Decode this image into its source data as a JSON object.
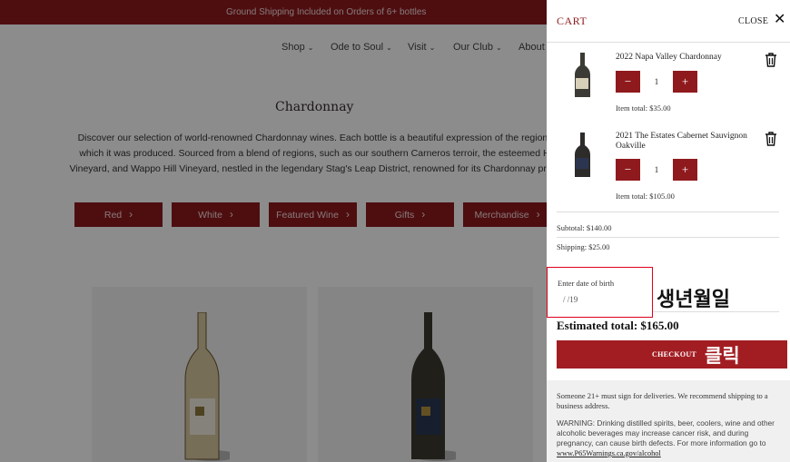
{
  "promo_bar": {
    "text": "Ground Shipping Included on Orders of 6+ bottles"
  },
  "nav": {
    "items": [
      {
        "label": "Shop"
      },
      {
        "label": "Ode to Soul"
      },
      {
        "label": "Visit"
      },
      {
        "label": "Our Club"
      },
      {
        "label": "About"
      }
    ]
  },
  "category": {
    "title": "Chardonnay",
    "description_lines": [
      "Discover our selection of world-renowned Chardonnay wines. Each bottle is a beautiful expression of the region fro",
      "which it was produced. Sourced from a blend of regions, such as our southern Carneros terroir, the esteemed Hyd",
      "Vineyard, and Wappo Hill Vineyard, nestled in the legendary Stag's Leap District, renowned for its Chardonnay product"
    ],
    "filter_buttons": [
      {
        "label": "Red"
      },
      {
        "label": "White"
      },
      {
        "label": "Featured Wine"
      },
      {
        "label": "Gifts"
      },
      {
        "label": "Merchandise"
      }
    ]
  },
  "cart": {
    "title": "CART",
    "close_label": "CLOSE",
    "items": [
      {
        "name": "2022 Napa Valley Chardonnay",
        "quantity": "1",
        "item_total": "Item total: $35.00"
      },
      {
        "name": "2021 The Estates Cabernet Sauvignon Oakville",
        "quantity": "1",
        "item_total": "Item total: $105.00"
      }
    ],
    "decrement_label": "−",
    "increment_label": "+",
    "subtotal": "Subtotal: $140.00",
    "shipping": "Shipping: $25.00",
    "dob_label": "Enter date of birth",
    "dob_value": "/ /19",
    "estimated_total": "Estimated total: $165.00",
    "checkout_label": "CHECKOUT",
    "notice": "Someone 21+ must sign for deliveries. We recommend shipping to a business address.",
    "warning": "WARNING: Drinking distilled spirits, beer, coolers, wine and other alcoholic beverages may increase cancer risk, and during pregnancy, can cause birth defects. For more information go to",
    "warning_link": "www.P65Warnings.ca.gov/alcohol"
  },
  "annotations": {
    "dob": "생년월일",
    "checkout": "클릭"
  },
  "colors": {
    "brand": "#8f1a1e",
    "checkout": "#a21d22",
    "highlight": "#e0001b"
  }
}
